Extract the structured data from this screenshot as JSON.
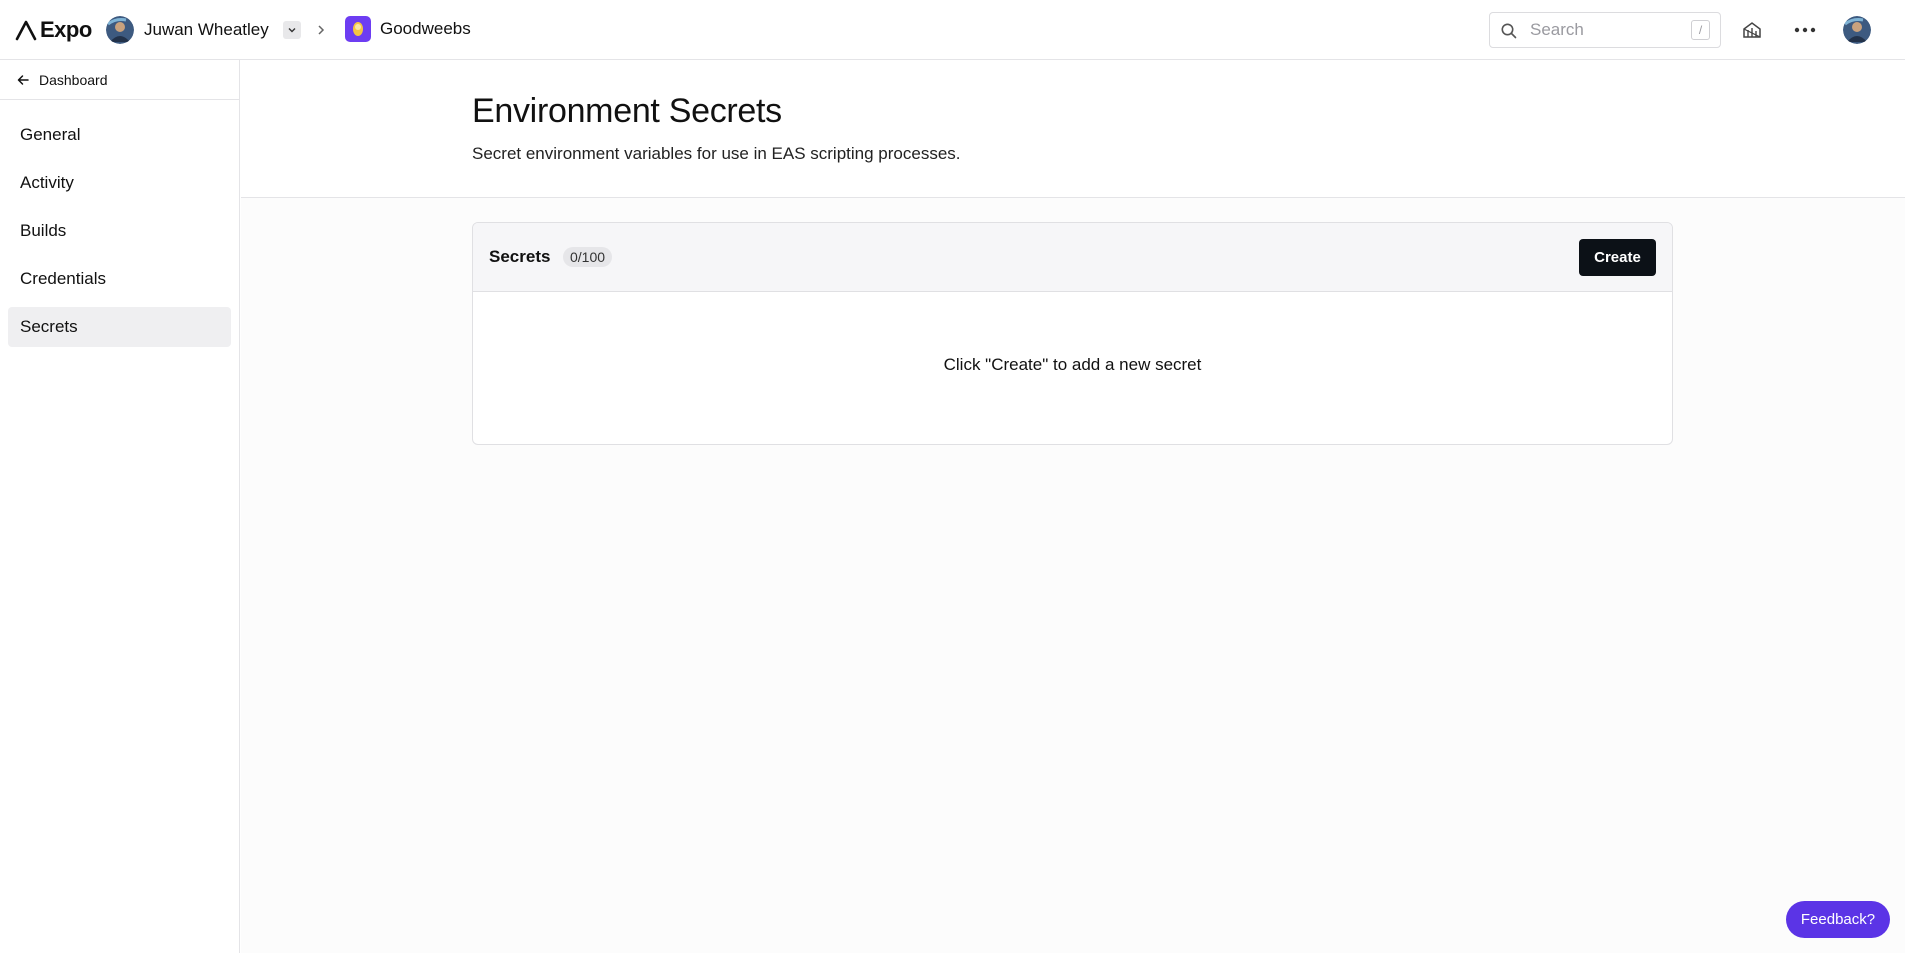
{
  "topbar": {
    "logo_text": "Expo",
    "account_name": "Juwan Wheatley",
    "project_name": "Goodweebs",
    "search_placeholder": "Search",
    "search_shortcut": "/"
  },
  "sidebar": {
    "back_label": "Dashboard",
    "items": [
      {
        "label": "General",
        "active": false
      },
      {
        "label": "Activity",
        "active": false
      },
      {
        "label": "Builds",
        "active": false
      },
      {
        "label": "Credentials",
        "active": false
      },
      {
        "label": "Secrets",
        "active": true
      }
    ]
  },
  "page": {
    "title": "Environment Secrets",
    "subtitle": "Secret environment variables for use in EAS scripting processes."
  },
  "secrets_card": {
    "title": "Secrets",
    "count": "0/100",
    "create_label": "Create",
    "empty_message": "Click \"Create\" to add a new secret"
  },
  "feedback_label": "Feedback?",
  "colors": {
    "accent": "#5b34e6",
    "project_icon": "#6d3df2",
    "primary_button": "#0c1117",
    "active_nav": "#efeff1"
  },
  "icons": [
    "expo-logo-icon",
    "avatar",
    "chevron-down-icon",
    "chevron-right-icon",
    "search-icon",
    "dev-tools-icon",
    "more-icon",
    "arrow-left-icon"
  ]
}
